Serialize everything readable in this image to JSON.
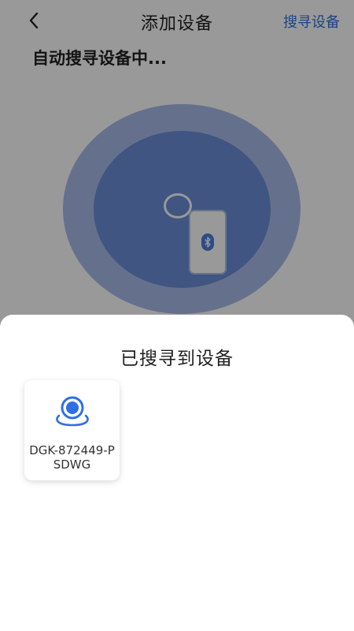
{
  "header": {
    "title": "添加设备",
    "action_label": "搜寻设备"
  },
  "status": {
    "searching_text": "自动搜寻设备中..."
  },
  "sheet": {
    "title": "已搜寻到设备",
    "devices": [
      {
        "name": "DGK-872449-PSDWG",
        "icon": "camera-icon"
      }
    ]
  },
  "colors": {
    "accent": "#2f6fe6",
    "radar_outer": "#a9bde9",
    "radar_inner": "#6c8ed8",
    "device_icon": "#2f6fe6"
  },
  "icons": {
    "back": "chevron-left-icon",
    "bluetooth": "bluetooth-icon",
    "device": "camera-icon"
  }
}
